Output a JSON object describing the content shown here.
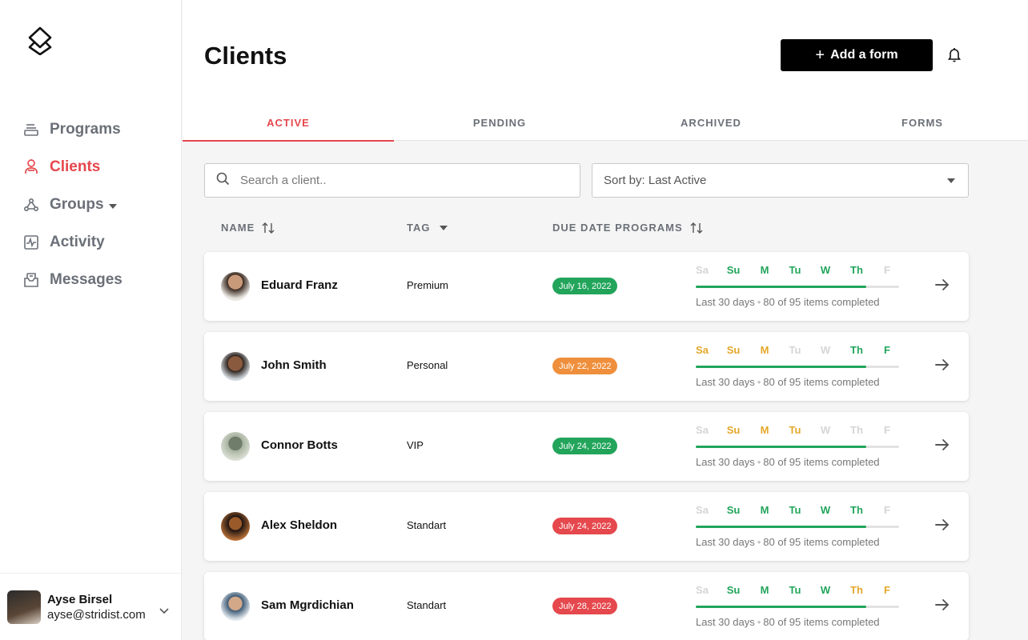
{
  "sidebar": {
    "logo_icon": "layers-logo-icon",
    "items": [
      {
        "label": "Programs",
        "icon": "programs-icon",
        "active": false
      },
      {
        "label": "Clients",
        "icon": "clients-icon",
        "active": true
      },
      {
        "label": "Groups",
        "icon": "groups-icon",
        "active": false,
        "has_dropdown": true
      },
      {
        "label": "Activity",
        "icon": "activity-icon",
        "active": false
      },
      {
        "label": "Messages",
        "icon": "messages-icon",
        "active": false
      }
    ],
    "user": {
      "name": "Ayse Birsel",
      "email": "ayse@stridist.com"
    }
  },
  "header": {
    "title": "Clients",
    "add_button_label": "Add a form",
    "add_button_icon": "plus-icon",
    "notification_icon": "bell-icon"
  },
  "tabs": [
    {
      "label": "ACTIVE",
      "active": true
    },
    {
      "label": "PENDING",
      "active": false
    },
    {
      "label": "ARCHIVED",
      "active": false
    },
    {
      "label": "FORMS",
      "active": false
    }
  ],
  "filters": {
    "search_placeholder": "Search a client..",
    "sort_label": "Sort by: Last Active"
  },
  "columns": {
    "name": "NAME",
    "tag": "TAG",
    "due_date": "DUE DATE PROGRAMS"
  },
  "colors": {
    "accent": "#e5484d",
    "done": "#22a55b",
    "partial": "#e3a82b",
    "missed": "#d5d5d5",
    "badge_green": "#22a55b",
    "badge_orange": "#ef8f3b",
    "badge_red": "#e5484d"
  },
  "day_labels": [
    "Sa",
    "Su",
    "M",
    "Tu",
    "W",
    "Th",
    "F"
  ],
  "clients": [
    {
      "name": "Eduard Franz",
      "tag": "Premium",
      "due": "July 16, 2022",
      "due_status": "green",
      "days": [
        "missed",
        "done",
        "done",
        "done",
        "done",
        "done",
        "missed"
      ],
      "progress": 0.84,
      "period": "Last 30 days",
      "completed": "80 of 95 items completed"
    },
    {
      "name": "John Smith",
      "tag": "Personal",
      "due": "July 22, 2022",
      "due_status": "orange",
      "days": [
        "partial",
        "partial",
        "partial",
        "missed",
        "missed",
        "done",
        "done"
      ],
      "progress": 0.84,
      "period": "Last 30 days",
      "completed": "80 of 95 items completed"
    },
    {
      "name": "Connor Botts",
      "tag": "VIP",
      "due": "July 24, 2022",
      "due_status": "green",
      "days": [
        "missed",
        "partial",
        "partial",
        "partial",
        "missed",
        "missed",
        "missed"
      ],
      "progress": 0.84,
      "period": "Last 30 days",
      "completed": "80 of 95 items completed"
    },
    {
      "name": "Alex Sheldon",
      "tag": "Standart",
      "due": "July 24, 2022",
      "due_status": "red",
      "days": [
        "missed",
        "done",
        "done",
        "done",
        "done",
        "done",
        "missed"
      ],
      "progress": 0.84,
      "period": "Last 30 days",
      "completed": "80 of 95 items completed"
    },
    {
      "name": "Sam Mgrdichian",
      "tag": "Standart",
      "due": "July 28, 2022",
      "due_status": "red",
      "days": [
        "missed",
        "done",
        "done",
        "done",
        "done",
        "partial",
        "partial"
      ],
      "progress": 0.84,
      "period": "Last 30 days",
      "completed": "80 of 95 items completed"
    }
  ]
}
